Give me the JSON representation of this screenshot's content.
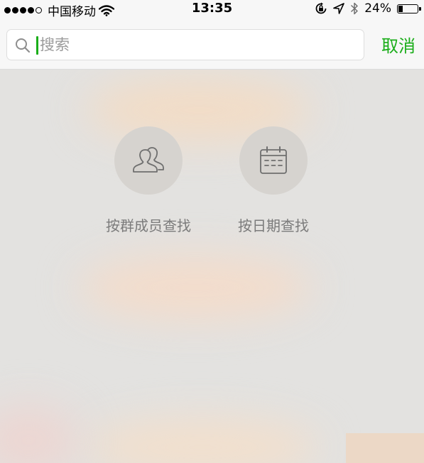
{
  "status_bar": {
    "carrier": "中国移动",
    "time": "13:35",
    "battery_text": "24%",
    "battery_level": 0.24,
    "signal_bars_filled": 4,
    "signal_bars_total": 5,
    "icons": [
      "wifi-icon",
      "rotation-lock-icon",
      "location-arrow-icon",
      "bluetooth-icon",
      "battery-icon"
    ]
  },
  "search": {
    "placeholder": "搜索",
    "value": "",
    "cancel_label": "取消"
  },
  "options": [
    {
      "label": "按群成员查找",
      "icon": "group-members-icon"
    },
    {
      "label": "按日期查找",
      "icon": "calendar-icon"
    }
  ],
  "colors": {
    "accent": "#1aad19",
    "label_gray": "#7b7b7b",
    "circle_bg": "#d6d3cf"
  }
}
